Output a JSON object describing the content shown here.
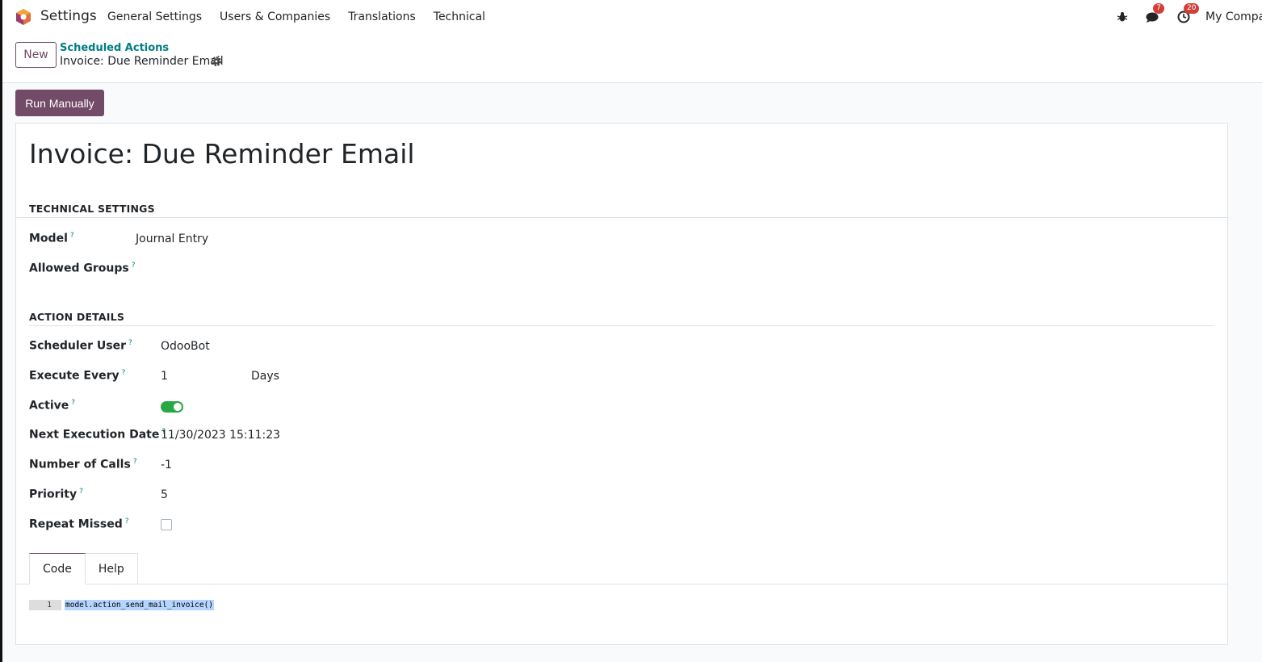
{
  "navbar": {
    "app_name": "Settings",
    "menu": [
      "General Settings",
      "Users & Companies",
      "Translations",
      "Technical"
    ],
    "messages_badge": "7",
    "activities_badge": "20",
    "company": "My Company",
    "icons": [
      "bug-icon",
      "chat-icon",
      "clock-icon"
    ]
  },
  "control": {
    "new_label": "New",
    "breadcrumb_parent": "Scheduled Actions",
    "breadcrumb_current": "Invoice: Due Reminder Email"
  },
  "run_manually_label": "Run Manually",
  "form": {
    "title": "Invoice: Due Reminder Email",
    "technical_settings": {
      "heading": "TECHNICAL SETTINGS",
      "model_label": "Model",
      "model_value": "Journal Entry",
      "allowed_groups_label": "Allowed Groups"
    },
    "action_details": {
      "heading": "ACTION DETAILS",
      "scheduler_user_label": "Scheduler User",
      "scheduler_user_value": "OdooBot",
      "execute_every_label": "Execute Every",
      "execute_every_value": "1",
      "execute_every_unit": "Days",
      "active_label": "Active",
      "active": true,
      "next_execution_label": "Next Execution Date",
      "next_execution_value": "11/30/2023 15:11:23",
      "number_of_calls_label": "Number of Calls",
      "number_of_calls_value": "-1",
      "priority_label": "Priority",
      "priority_value": "5",
      "repeat_missed_label": "Repeat Missed",
      "repeat_missed": false
    },
    "help_marker": "?",
    "tabs": [
      "Code",
      "Help"
    ],
    "code": {
      "line_number": "1",
      "line": "model.action_send_mail_invoice()"
    }
  },
  "colors": {
    "brand": "#714b67",
    "link": "#017e84",
    "toggle_on": "#28a745",
    "badge": "#d23f3a"
  }
}
